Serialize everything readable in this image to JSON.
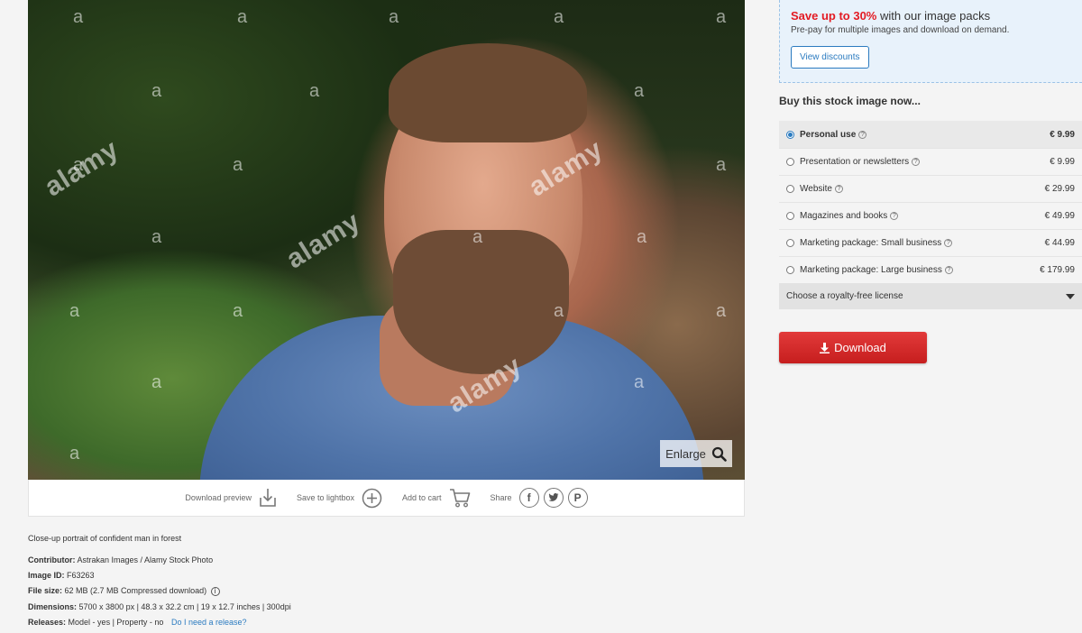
{
  "image": {
    "watermark_logo": "alamy",
    "watermark_letter": "a",
    "enlarge_label": "Enlarge"
  },
  "actions": {
    "download_preview": "Download preview",
    "save_to_lightbox": "Save to lightbox",
    "add_to_cart": "Add to cart",
    "share": "Share",
    "share_icons": [
      "facebook-icon",
      "twitter-icon",
      "pinterest-icon"
    ]
  },
  "details": {
    "caption": "Close-up portrait of confident man in forest",
    "contributor_label": "Contributor:",
    "contributor": "Astrakan Images / Alamy Stock Photo",
    "image_id_label": "Image ID:",
    "image_id": "F63263",
    "file_size_label": "File size:",
    "file_size": "62 MB (2.7 MB Compressed download)",
    "dimensions_label": "Dimensions:",
    "dimensions": "5700 x 3800 px | 48.3 x 32.2 cm | 19 x 12.7 inches | 300dpi",
    "releases_label": "Releases:",
    "releases": "Model - yes | Property - no",
    "release_link": "Do I need a release?"
  },
  "promo": {
    "highlight": "Save up to 30%",
    "headline_rest": "with our image packs",
    "sub": "Pre-pay for multiple images and download on demand.",
    "button": "View discounts"
  },
  "buy": {
    "title": "Buy this stock image now...",
    "licenses": [
      {
        "label": "Personal use",
        "price": "€ 9.99",
        "selected": true
      },
      {
        "label": "Presentation or newsletters",
        "price": "€ 9.99",
        "selected": false
      },
      {
        "label": "Website",
        "price": "€ 29.99",
        "selected": false
      },
      {
        "label": "Magazines and books",
        "price": "€ 49.99",
        "selected": false
      },
      {
        "label": "Marketing package: Small business",
        "price": "€ 44.99",
        "selected": false
      },
      {
        "label": "Marketing package: Large business",
        "price": "€ 179.99",
        "selected": false
      }
    ],
    "royalty_free": "Choose a royalty-free license",
    "download_button": "Download"
  },
  "colors": {
    "accent_red": "#e31b23",
    "link_blue": "#2b7bc0",
    "download_red": "#c61e1e"
  }
}
